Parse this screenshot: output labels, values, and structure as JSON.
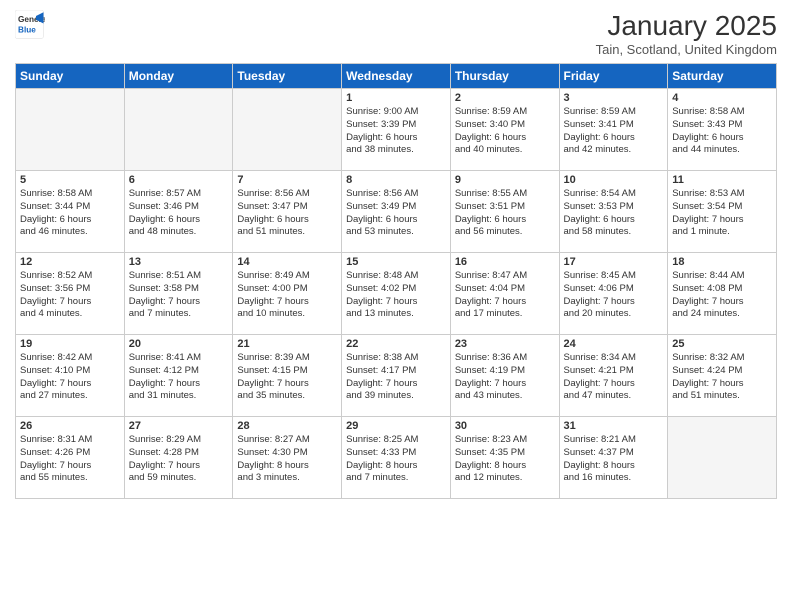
{
  "logo": {
    "general": "General",
    "blue": "Blue"
  },
  "title": "January 2025",
  "location": "Tain, Scotland, United Kingdom",
  "days_of_week": [
    "Sunday",
    "Monday",
    "Tuesday",
    "Wednesday",
    "Thursday",
    "Friday",
    "Saturday"
  ],
  "weeks": [
    [
      {
        "day": "",
        "info": ""
      },
      {
        "day": "",
        "info": ""
      },
      {
        "day": "",
        "info": ""
      },
      {
        "day": "1",
        "info": "Sunrise: 9:00 AM\nSunset: 3:39 PM\nDaylight: 6 hours\nand 38 minutes."
      },
      {
        "day": "2",
        "info": "Sunrise: 8:59 AM\nSunset: 3:40 PM\nDaylight: 6 hours\nand 40 minutes."
      },
      {
        "day": "3",
        "info": "Sunrise: 8:59 AM\nSunset: 3:41 PM\nDaylight: 6 hours\nand 42 minutes."
      },
      {
        "day": "4",
        "info": "Sunrise: 8:58 AM\nSunset: 3:43 PM\nDaylight: 6 hours\nand 44 minutes."
      }
    ],
    [
      {
        "day": "5",
        "info": "Sunrise: 8:58 AM\nSunset: 3:44 PM\nDaylight: 6 hours\nand 46 minutes."
      },
      {
        "day": "6",
        "info": "Sunrise: 8:57 AM\nSunset: 3:46 PM\nDaylight: 6 hours\nand 48 minutes."
      },
      {
        "day": "7",
        "info": "Sunrise: 8:56 AM\nSunset: 3:47 PM\nDaylight: 6 hours\nand 51 minutes."
      },
      {
        "day": "8",
        "info": "Sunrise: 8:56 AM\nSunset: 3:49 PM\nDaylight: 6 hours\nand 53 minutes."
      },
      {
        "day": "9",
        "info": "Sunrise: 8:55 AM\nSunset: 3:51 PM\nDaylight: 6 hours\nand 56 minutes."
      },
      {
        "day": "10",
        "info": "Sunrise: 8:54 AM\nSunset: 3:53 PM\nDaylight: 6 hours\nand 58 minutes."
      },
      {
        "day": "11",
        "info": "Sunrise: 8:53 AM\nSunset: 3:54 PM\nDaylight: 7 hours\nand 1 minute."
      }
    ],
    [
      {
        "day": "12",
        "info": "Sunrise: 8:52 AM\nSunset: 3:56 PM\nDaylight: 7 hours\nand 4 minutes."
      },
      {
        "day": "13",
        "info": "Sunrise: 8:51 AM\nSunset: 3:58 PM\nDaylight: 7 hours\nand 7 minutes."
      },
      {
        "day": "14",
        "info": "Sunrise: 8:49 AM\nSunset: 4:00 PM\nDaylight: 7 hours\nand 10 minutes."
      },
      {
        "day": "15",
        "info": "Sunrise: 8:48 AM\nSunset: 4:02 PM\nDaylight: 7 hours\nand 13 minutes."
      },
      {
        "day": "16",
        "info": "Sunrise: 8:47 AM\nSunset: 4:04 PM\nDaylight: 7 hours\nand 17 minutes."
      },
      {
        "day": "17",
        "info": "Sunrise: 8:45 AM\nSunset: 4:06 PM\nDaylight: 7 hours\nand 20 minutes."
      },
      {
        "day": "18",
        "info": "Sunrise: 8:44 AM\nSunset: 4:08 PM\nDaylight: 7 hours\nand 24 minutes."
      }
    ],
    [
      {
        "day": "19",
        "info": "Sunrise: 8:42 AM\nSunset: 4:10 PM\nDaylight: 7 hours\nand 27 minutes."
      },
      {
        "day": "20",
        "info": "Sunrise: 8:41 AM\nSunset: 4:12 PM\nDaylight: 7 hours\nand 31 minutes."
      },
      {
        "day": "21",
        "info": "Sunrise: 8:39 AM\nSunset: 4:15 PM\nDaylight: 7 hours\nand 35 minutes."
      },
      {
        "day": "22",
        "info": "Sunrise: 8:38 AM\nSunset: 4:17 PM\nDaylight: 7 hours\nand 39 minutes."
      },
      {
        "day": "23",
        "info": "Sunrise: 8:36 AM\nSunset: 4:19 PM\nDaylight: 7 hours\nand 43 minutes."
      },
      {
        "day": "24",
        "info": "Sunrise: 8:34 AM\nSunset: 4:21 PM\nDaylight: 7 hours\nand 47 minutes."
      },
      {
        "day": "25",
        "info": "Sunrise: 8:32 AM\nSunset: 4:24 PM\nDaylight: 7 hours\nand 51 minutes."
      }
    ],
    [
      {
        "day": "26",
        "info": "Sunrise: 8:31 AM\nSunset: 4:26 PM\nDaylight: 7 hours\nand 55 minutes."
      },
      {
        "day": "27",
        "info": "Sunrise: 8:29 AM\nSunset: 4:28 PM\nDaylight: 7 hours\nand 59 minutes."
      },
      {
        "day": "28",
        "info": "Sunrise: 8:27 AM\nSunset: 4:30 PM\nDaylight: 8 hours\nand 3 minutes."
      },
      {
        "day": "29",
        "info": "Sunrise: 8:25 AM\nSunset: 4:33 PM\nDaylight: 8 hours\nand 7 minutes."
      },
      {
        "day": "30",
        "info": "Sunrise: 8:23 AM\nSunset: 4:35 PM\nDaylight: 8 hours\nand 12 minutes."
      },
      {
        "day": "31",
        "info": "Sunrise: 8:21 AM\nSunset: 4:37 PM\nDaylight: 8 hours\nand 16 minutes."
      },
      {
        "day": "",
        "info": ""
      }
    ]
  ]
}
